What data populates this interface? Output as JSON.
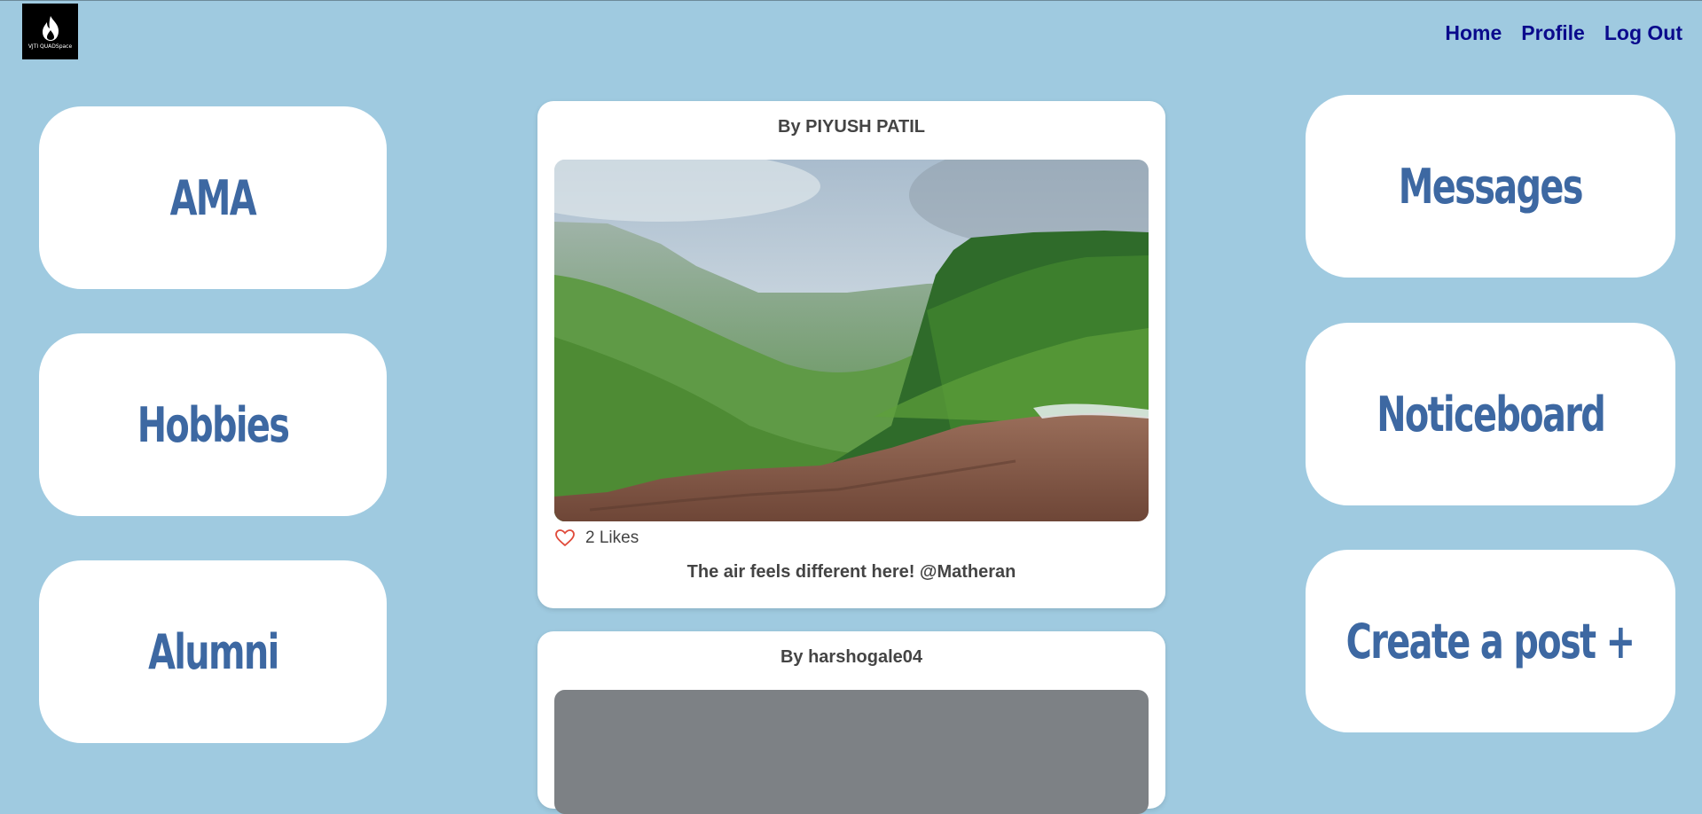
{
  "logo": {
    "text": "VJTI QUADSpace",
    "icon": "flame-icon"
  },
  "nav": {
    "home": "Home",
    "profile": "Profile",
    "logout": "Log Out"
  },
  "left_tiles": {
    "ama": "AMA",
    "hobbies": "Hobbies",
    "alumni": "Alumni"
  },
  "right_tiles": {
    "messages": "Messages",
    "noticeboard": "Noticeboard",
    "create": "Create a post +"
  },
  "posts": [
    {
      "author": "By PIYUSH PATIL",
      "likes": "2 Likes",
      "caption": "The air feels different here! @Matheran",
      "like_icon": "heart-outline-icon"
    },
    {
      "author": "By harshogale04"
    }
  ],
  "colors": {
    "background": "#9fcae0",
    "tile_text": "#3d68a2",
    "nav_text": "#0a0a8c",
    "like_heart": "#e04a3a"
  }
}
